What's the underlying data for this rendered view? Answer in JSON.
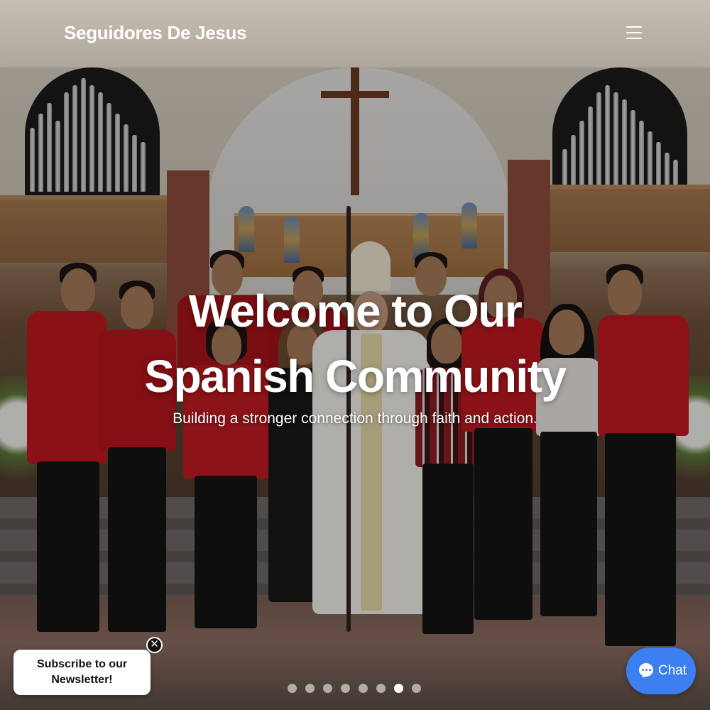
{
  "header": {
    "brand": "Seguidores De Jesus",
    "menu_icon": "hamburger-menu-icon"
  },
  "hero": {
    "title_line1": "Welcome to Our",
    "title_line2": "Spanish Community",
    "subtitle": "Building a stronger connection through faith and action.",
    "slides_total": 8,
    "active_slide": 7
  },
  "newsletter": {
    "line1": "Subscribe to our",
    "line2": "Newsletter!",
    "close_icon": "close-icon",
    "close_glyph": "✕"
  },
  "chat": {
    "label": "Chat",
    "icon": "chat-bubble-icon"
  },
  "colors": {
    "chat_button": "#3b7ff0",
    "shirt_red": "#c0191f",
    "text": "#ffffff"
  }
}
